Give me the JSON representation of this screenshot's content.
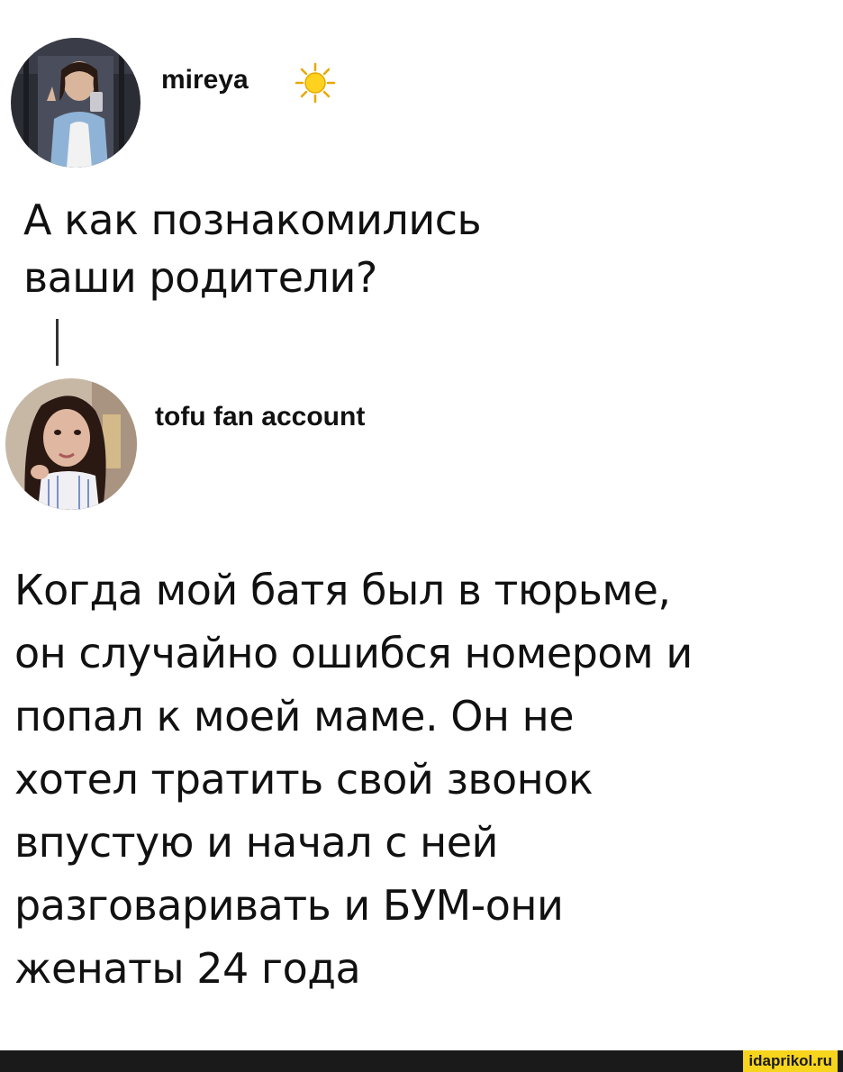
{
  "posts": [
    {
      "username": "mireya",
      "emoji_icon": "sun-icon",
      "text_lines": [
        "А как познакомились",
        "ваши родители?"
      ]
    },
    {
      "username": "tofu fan account",
      "text_lines": [
        "Когда мой батя был в тюрьме,",
        "он случайно ошибся номером и",
        "попал к моей маме. Он не",
        "хотел тратить свой звонок",
        "впустую и начал с ней",
        "разговаривать и БУМ-они",
        "женаты 24 года"
      ]
    }
  ],
  "watermark": "idaprikol.ru",
  "colors": {
    "text": "#111111",
    "background": "#ffffff",
    "watermark_bg": "#f7d51d",
    "bottom_bar": "#1a1a1a"
  }
}
